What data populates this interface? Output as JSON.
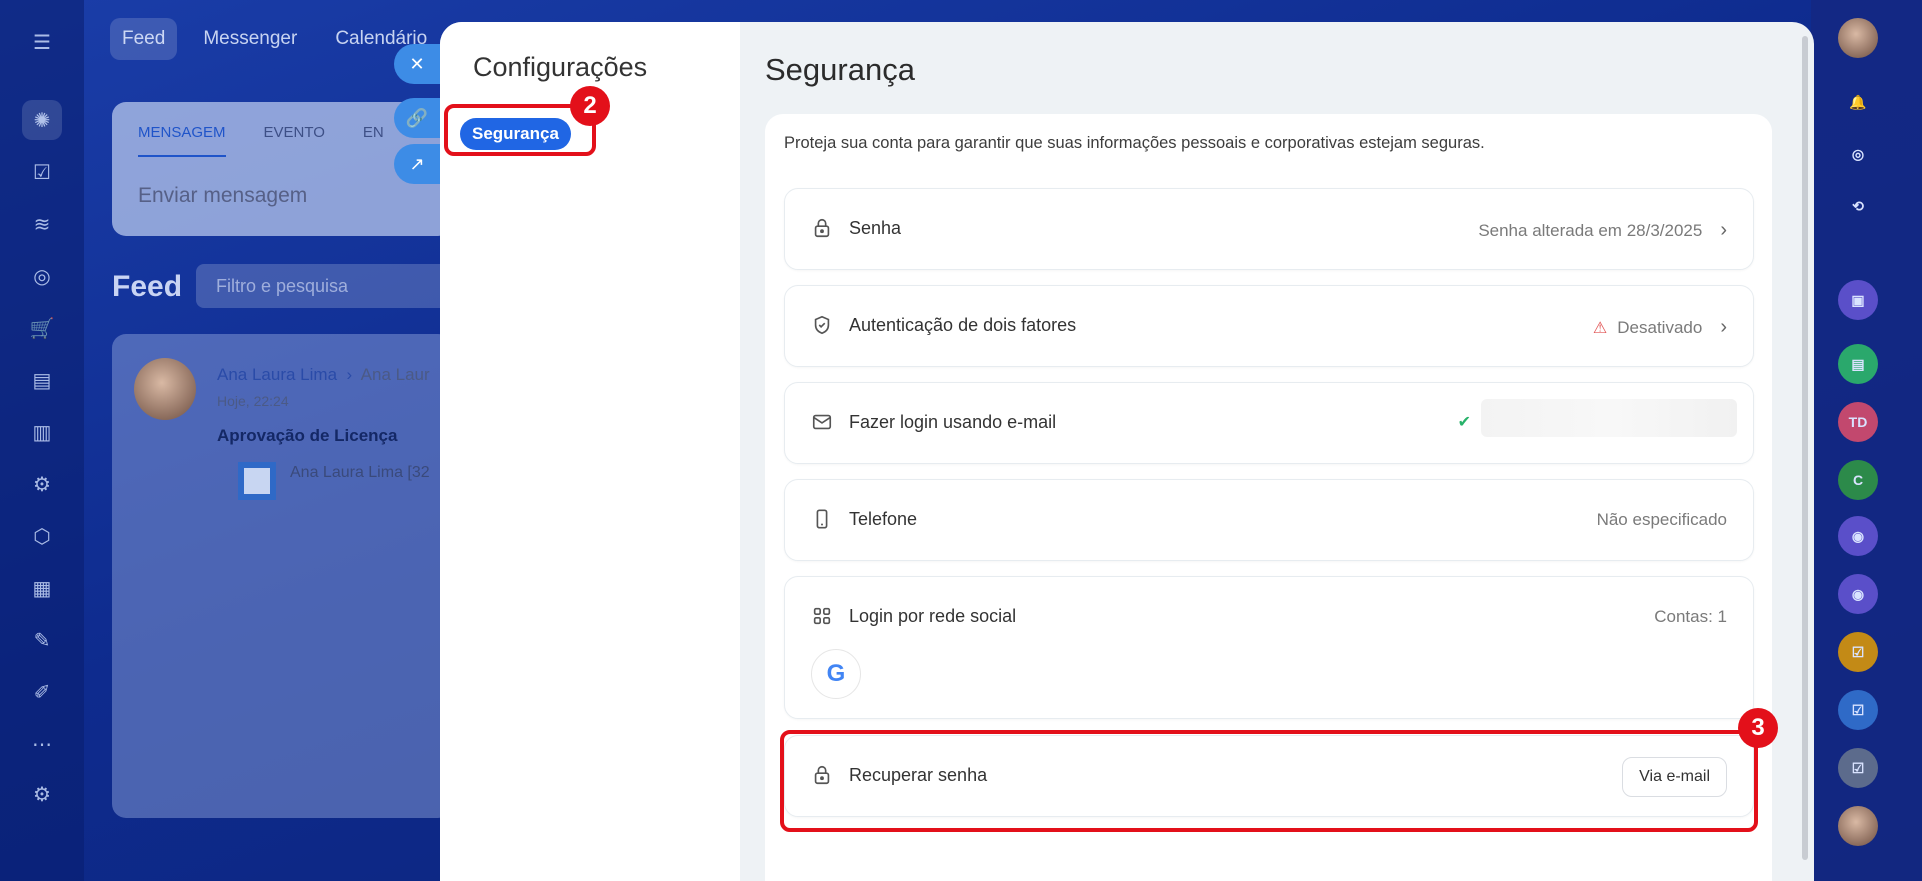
{
  "background": {
    "top_nav": [
      "Feed",
      "Messenger",
      "Calendário"
    ],
    "composer": {
      "tabs": [
        "MENSAGEM",
        "EVENTO",
        "EN"
      ],
      "placeholder": "Enviar mensagem"
    },
    "feed": {
      "title": "Feed",
      "filter_placeholder": "Filtro e pesquisa"
    },
    "post": {
      "author": "Ana Laura Lima",
      "recipient": "Ana Laur",
      "time": "Hoje, 22:24",
      "subject": "Aprovação de Licença",
      "line": "Ana Laura Lima [32"
    },
    "right_rail": {
      "badge_td": "TD",
      "badge_c": "C"
    }
  },
  "panel": {
    "settings_title": "Configurações",
    "settings_item": "Segurança",
    "section_title": "Segurança",
    "intro": "Proteja sua conta para garantir que suas informações pessoais e corporativas estejam seguras.",
    "markers": {
      "m2": "2",
      "m3": "3"
    },
    "rows": {
      "password": {
        "label": "Senha",
        "value": "Senha alterada em 28/3/2025"
      },
      "twofa": {
        "label": "Autenticação de dois fatores",
        "value": "Desativado"
      },
      "email": {
        "label": "Fazer login usando e-mail"
      },
      "phone": {
        "label": "Telefone",
        "value": "Não especificado"
      },
      "social": {
        "label": "Login por rede social",
        "value": "Contas: 1",
        "provider_glyph": "G"
      },
      "recover": {
        "label": "Recuperar senha",
        "button": "Via e-mail"
      }
    }
  },
  "colors": {
    "accent": "#2066e4",
    "highlight": "#e3101a",
    "warning": "#e25555",
    "success": "#28b26a"
  }
}
